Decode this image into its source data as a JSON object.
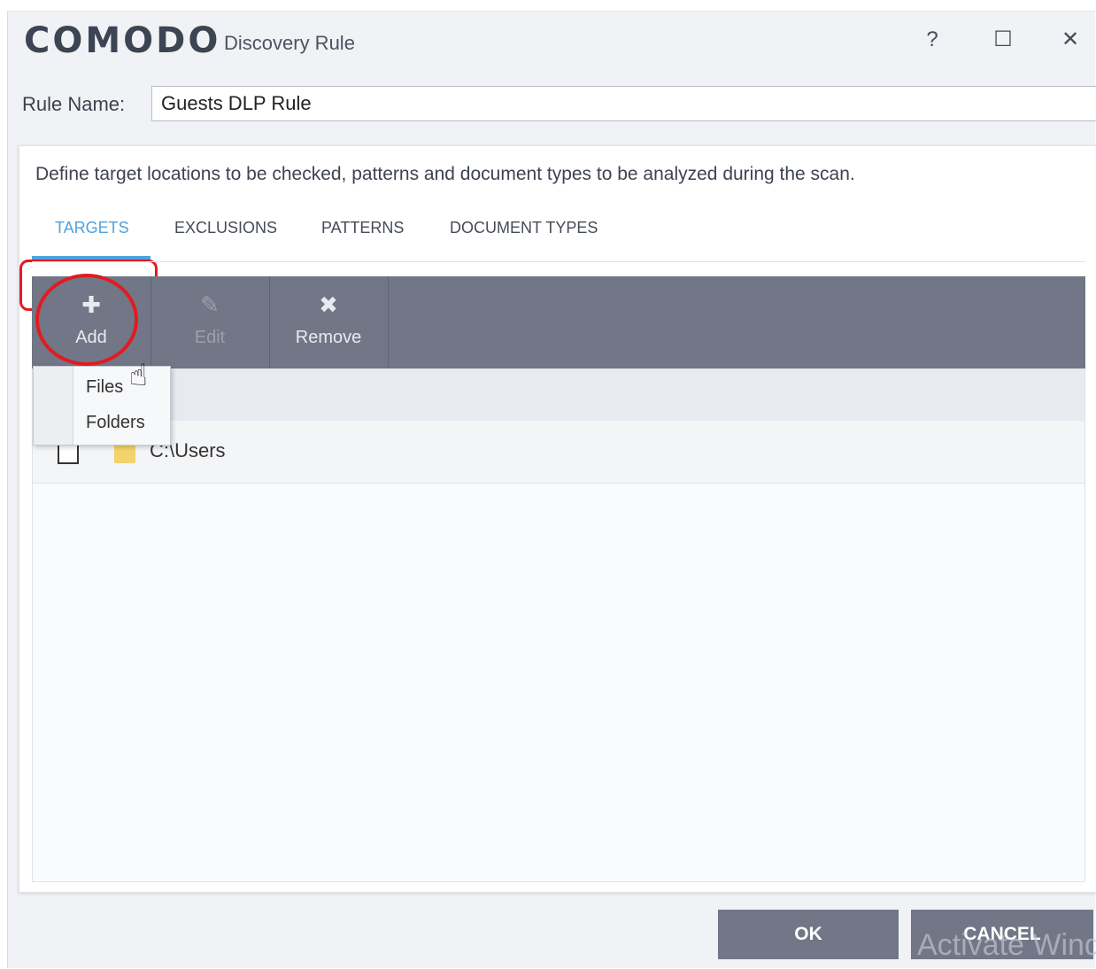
{
  "window": {
    "brand": "COMODO",
    "title": "Discovery Rule",
    "controls": {
      "help": "?",
      "maximize": "☐",
      "close": "✕"
    }
  },
  "rule_name": {
    "label": "Rule Name:",
    "value": "Guests DLP Rule"
  },
  "description": "Define target locations to be checked, patterns and document types to be analyzed during the scan.",
  "tabs": [
    {
      "label": "TARGETS",
      "active": true
    },
    {
      "label": "EXCLUSIONS",
      "active": false
    },
    {
      "label": "PATTERNS",
      "active": false
    },
    {
      "label": "DOCUMENT TYPES",
      "active": false
    }
  ],
  "toolbar": {
    "add": {
      "icon": "plus-icon",
      "glyph": "✚",
      "label": "Add"
    },
    "edit": {
      "icon": "pencil-icon",
      "glyph": "✎",
      "label": "Edit",
      "disabled": true
    },
    "remove": {
      "icon": "x-icon",
      "glyph": "✖",
      "label": "Remove"
    }
  },
  "add_menu": {
    "items": [
      "Files",
      "Folders"
    ]
  },
  "targets": [
    {
      "icon": "folder-icon",
      "path": "C:\\Users",
      "checked": false
    }
  ],
  "buttons": {
    "ok": "OK",
    "cancel": "CANCEL"
  },
  "watermark": "Activate Windows",
  "colors": {
    "accent": "#4ea3df",
    "toolbar": "#717787",
    "highlight": "#e21b22"
  }
}
